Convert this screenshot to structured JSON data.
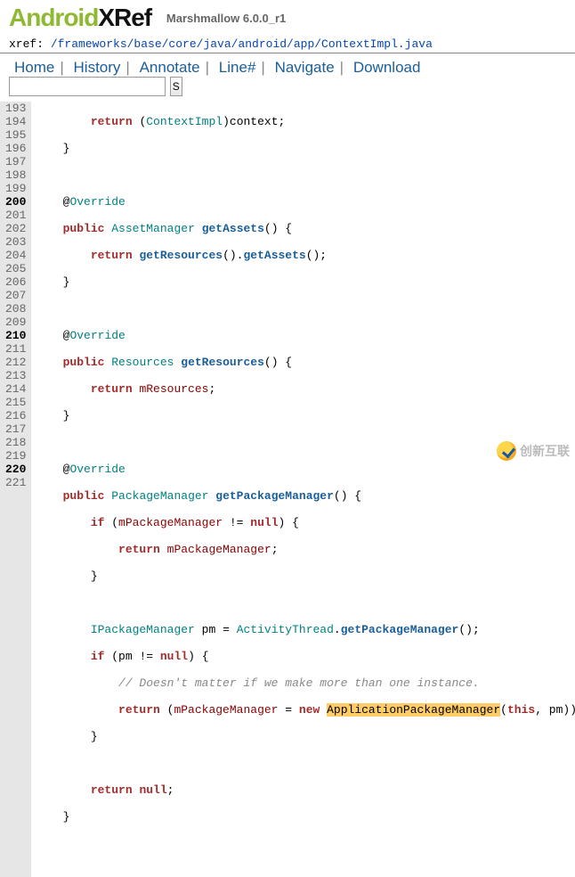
{
  "header": {
    "logo_green": "Android",
    "logo_black": "XRef",
    "subtitle": "Marshmallow 6.0.0_r1"
  },
  "xref": {
    "label": "xref: ",
    "path": "/frameworks/base/core/java/android/app/ContextImpl.java"
  },
  "nav": {
    "home": "Home",
    "history": "History",
    "annotate": "Annotate",
    "line": "Line#",
    "navigate": "Navigate",
    "download": "Download",
    "search_btn": "S"
  },
  "gutter_lines": [
    "193",
    "194",
    "195",
    "196",
    "197",
    "198",
    "199",
    "200",
    "201",
    "202",
    "203",
    "204",
    "205",
    "206",
    "207",
    "208",
    "209",
    "210",
    "211",
    "212",
    "213",
    "214",
    "215",
    "216",
    "217",
    "218",
    "219",
    "220",
    "221"
  ],
  "gutter_bold": [
    "200",
    "210",
    "220"
  ],
  "code": {
    "l193": {
      "indent": "        ",
      "kw_return": "return",
      "open": " (",
      "type": "ContextImpl",
      "close": ")",
      "id": "context",
      "semi": ";"
    },
    "l194": {
      "indent": "    ",
      "brace": "}"
    },
    "l197": {
      "indent": "    ",
      "at": "@",
      "ovr": "Override"
    },
    "l198": {
      "indent": "    ",
      "kw_public": "public",
      "sp": " ",
      "type": "AssetManager",
      "sp2": " ",
      "fn": "getAssets",
      "paren": "() {"
    },
    "l199": {
      "indent": "        ",
      "kw_return": "return",
      "sp": " ",
      "fn1": "getResources",
      "par1": "().",
      "fn2": "getAssets",
      "par2": "();"
    },
    "l200": {
      "indent": "    ",
      "brace": "}"
    },
    "l202": {
      "indent": "    ",
      "at": "@",
      "ovr": "Override"
    },
    "l203": {
      "indent": "    ",
      "kw_public": "public",
      "sp": " ",
      "type": "Resources",
      "sp2": " ",
      "fn": "getResources",
      "paren": "() {"
    },
    "l204": {
      "indent": "        ",
      "kw_return": "return",
      "sp": " ",
      "fld": "mResources",
      "semi": ";"
    },
    "l205": {
      "indent": "    ",
      "brace": "}"
    },
    "l207": {
      "indent": "    ",
      "at": "@",
      "ovr": "Override"
    },
    "l208": {
      "indent": "    ",
      "kw_public": "public",
      "sp": " ",
      "type": "PackageManager",
      "sp2": " ",
      "fn": "getPackageManager",
      "paren": "() {"
    },
    "l209": {
      "indent": "        ",
      "kw_if": "if",
      "open": " (",
      "fld": "mPackageManager",
      "neq": " != ",
      "kw_null": "null",
      "close": ") {"
    },
    "l210": {
      "indent": "            ",
      "kw_return": "return",
      "sp": " ",
      "fld": "mPackageManager",
      "semi": ";"
    },
    "l211": {
      "indent": "        ",
      "brace": "}"
    },
    "l213": {
      "indent": "        ",
      "type": "IPackageManager",
      "sp": " ",
      "id": "pm",
      "eq": " = ",
      "type2": "ActivityThread",
      "dot": ".",
      "fn": "getPackageManager",
      "par": "();"
    },
    "l214": {
      "indent": "        ",
      "kw_if": "if",
      "open": " (",
      "id": "pm",
      "neq": " != ",
      "kw_null": "null",
      "close": ") {"
    },
    "l215": {
      "indent": "            ",
      "cmnt": "// Doesn't matter if we make more than one instance."
    },
    "l216": {
      "indent": "            ",
      "kw_return": "return",
      "open": " (",
      "fld": "mPackageManager",
      "eq": " = ",
      "kw_new": "new",
      "sp": " ",
      "hl": "ApplicationPackageManager",
      "open2": "(",
      "kw_this": "this",
      "comma": ", ",
      "id": "pm",
      "close": "));"
    },
    "l217": {
      "indent": "        ",
      "brace": "}"
    },
    "l219": {
      "indent": "        ",
      "kw_return": "return",
      "sp": " ",
      "kw_null": "null",
      "semi": ";"
    },
    "l220": {
      "indent": "    ",
      "brace": "}"
    }
  },
  "watermark": "创新互联"
}
